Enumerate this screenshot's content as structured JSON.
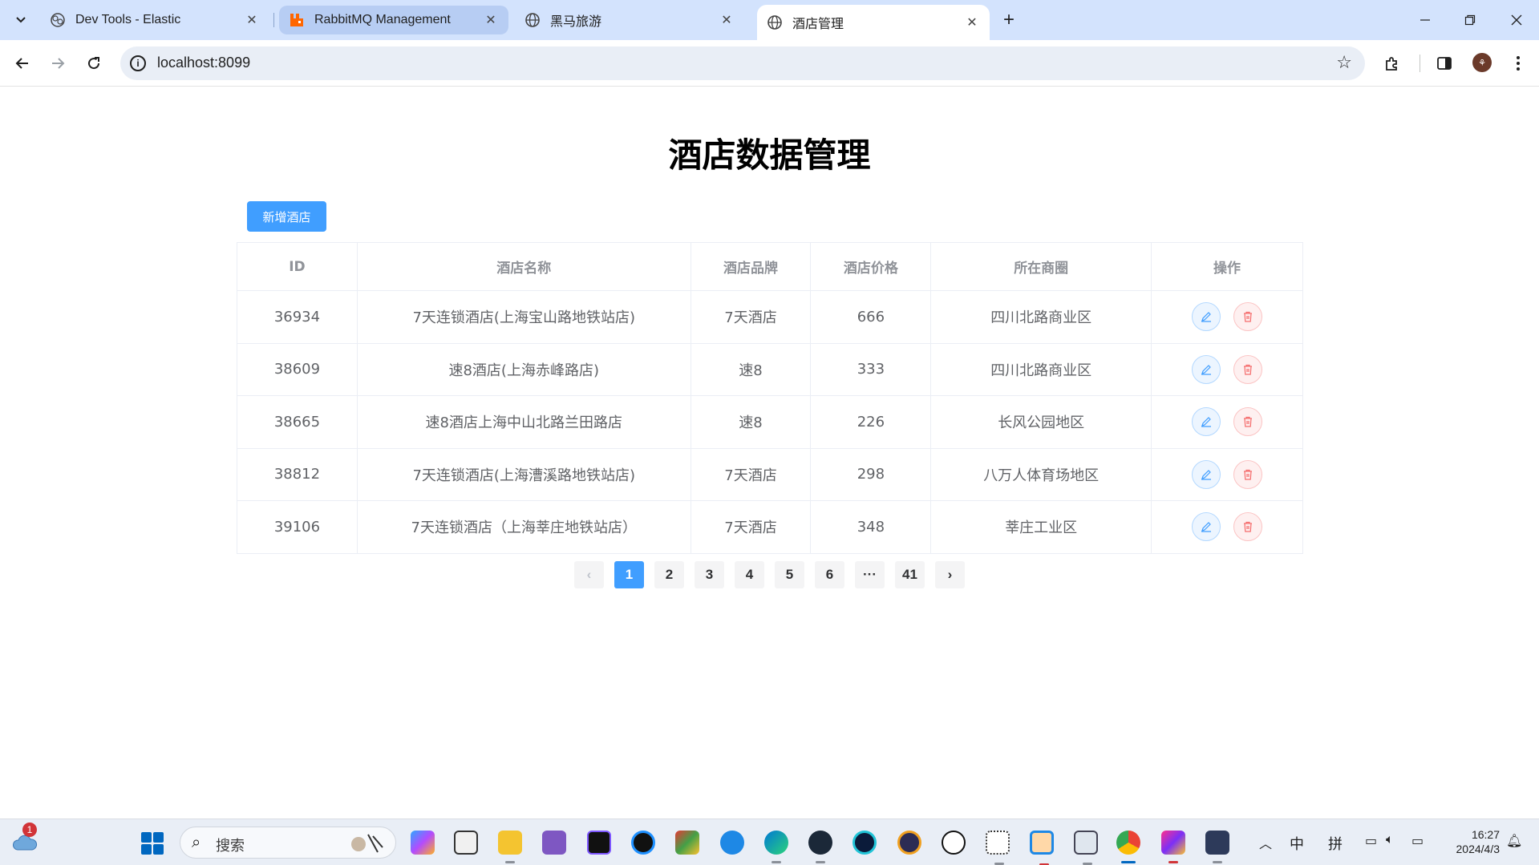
{
  "browser": {
    "tabs": [
      {
        "title": "Dev Tools - Elastic",
        "favicon": "elastic-icon",
        "state": "inactive"
      },
      {
        "title": "RabbitMQ Management",
        "favicon": "rabbitmq-icon",
        "state": "hover"
      },
      {
        "title": "黑马旅游",
        "favicon": "globe-icon",
        "state": "inactive"
      },
      {
        "title": "酒店管理",
        "favicon": "globe-icon",
        "state": "active"
      }
    ],
    "url": "localhost:8099"
  },
  "page": {
    "title": "酒店数据管理",
    "add_button": "新增酒店",
    "table": {
      "headers": [
        "ID",
        "酒店名称",
        "酒店品牌",
        "酒店价格",
        "所在商圈",
        "操作"
      ],
      "rows": [
        {
          "id": "36934",
          "name": "7天连锁酒店(上海宝山路地铁站店)",
          "brand": "7天酒店",
          "price": "666",
          "area": "四川北路商业区"
        },
        {
          "id": "38609",
          "name": "速8酒店(上海赤峰路店)",
          "brand": "速8",
          "price": "333",
          "area": "四川北路商业区"
        },
        {
          "id": "38665",
          "name": "速8酒店上海中山北路兰田路店",
          "brand": "速8",
          "price": "226",
          "area": "长风公园地区"
        },
        {
          "id": "38812",
          "name": "7天连锁酒店(上海漕溪路地铁站店)",
          "brand": "7天酒店",
          "price": "298",
          "area": "八万人体育场地区"
        },
        {
          "id": "39106",
          "name": "7天连锁酒店（上海莘庄地铁站店）",
          "brand": "7天酒店",
          "price": "348",
          "area": "莘庄工业区"
        }
      ]
    },
    "pagination": {
      "prev": "‹",
      "pages": [
        "1",
        "2",
        "3",
        "4",
        "5",
        "6",
        "···",
        "41"
      ],
      "current": "1",
      "next": "›"
    }
  },
  "taskbar": {
    "weather_badge": "1",
    "search_placeholder": "搜索",
    "ime_lang": "中",
    "ime_mode": "拼",
    "time": "16:27",
    "date": "2024/4/3"
  },
  "colors": {
    "primary": "#409eff",
    "danger": "#f56c6c",
    "tab_strip": "#d3e3fd"
  }
}
